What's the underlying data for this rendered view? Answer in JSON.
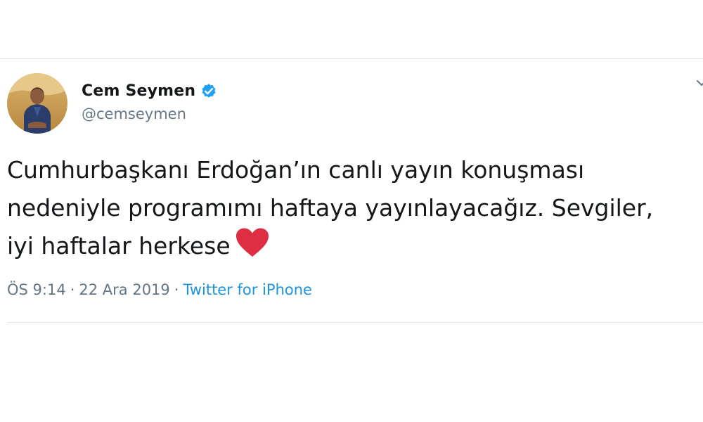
{
  "tweet": {
    "author": {
      "display_name": "Cem Seymen",
      "handle": "@cemseymen",
      "verified": true,
      "avatar_icon": "avatar-photo"
    },
    "text": "Cumhurbaşkanı Erdoğan’ın canlı yayın konuşması\nnedeniyle programımı haftaya yayınlayacağız. Sevgiler,\niyi haftalar herkese",
    "emoji": "red-heart-icon",
    "time": "ÖS 9:14",
    "separator": "·",
    "date": "22 Ara 2019",
    "source": "Twitter for iPhone"
  },
  "colors": {
    "text_primary": "#14171a",
    "text_secondary": "#657786",
    "link": "#1b95e0",
    "verified_badge": "#1da1f2",
    "heart": "#dd2e44",
    "divider": "#e1e8ed"
  }
}
